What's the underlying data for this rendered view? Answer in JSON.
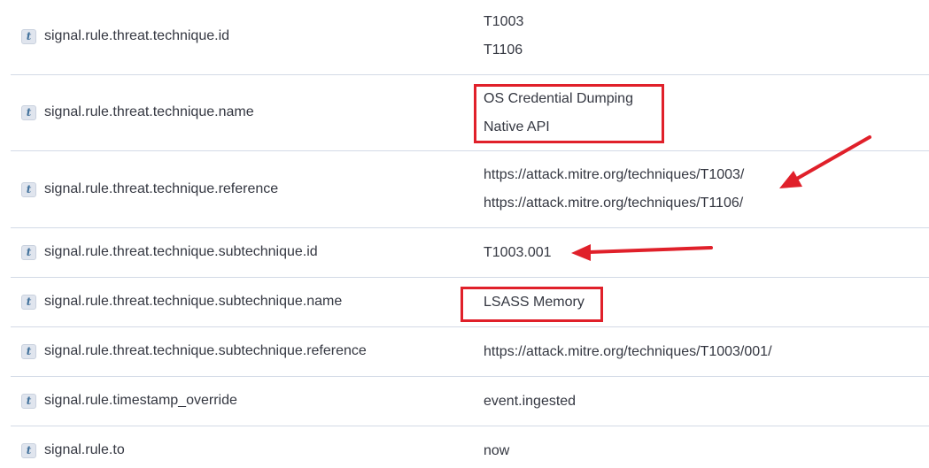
{
  "rows": [
    {
      "type": "t",
      "field": "signal.rule.threat.technique.id",
      "values": [
        "T1003",
        "T1106"
      ]
    },
    {
      "type": "t",
      "field": "signal.rule.threat.technique.name",
      "values": [
        "OS Credential Dumping",
        "Native API"
      ]
    },
    {
      "type": "t",
      "field": "signal.rule.threat.technique.reference",
      "values": [
        "https://attack.mitre.org/techniques/T1003/",
        "https://attack.mitre.org/techniques/T1106/"
      ]
    },
    {
      "type": "t",
      "field": "signal.rule.threat.technique.subtechnique.id",
      "values": [
        "T1003.001"
      ]
    },
    {
      "type": "t",
      "field": "signal.rule.threat.technique.subtechnique.name",
      "values": [
        "LSASS Memory"
      ]
    },
    {
      "type": "t",
      "field": "signal.rule.threat.technique.subtechnique.reference",
      "values": [
        "https://attack.mitre.org/techniques/T1003/001/"
      ]
    },
    {
      "type": "t",
      "field": "signal.rule.timestamp_override",
      "values": [
        "event.ingested"
      ]
    },
    {
      "type": "t",
      "field": "signal.rule.to",
      "values": [
        "now"
      ]
    }
  ],
  "annotations": {
    "highlight_color": "#e0202a"
  }
}
